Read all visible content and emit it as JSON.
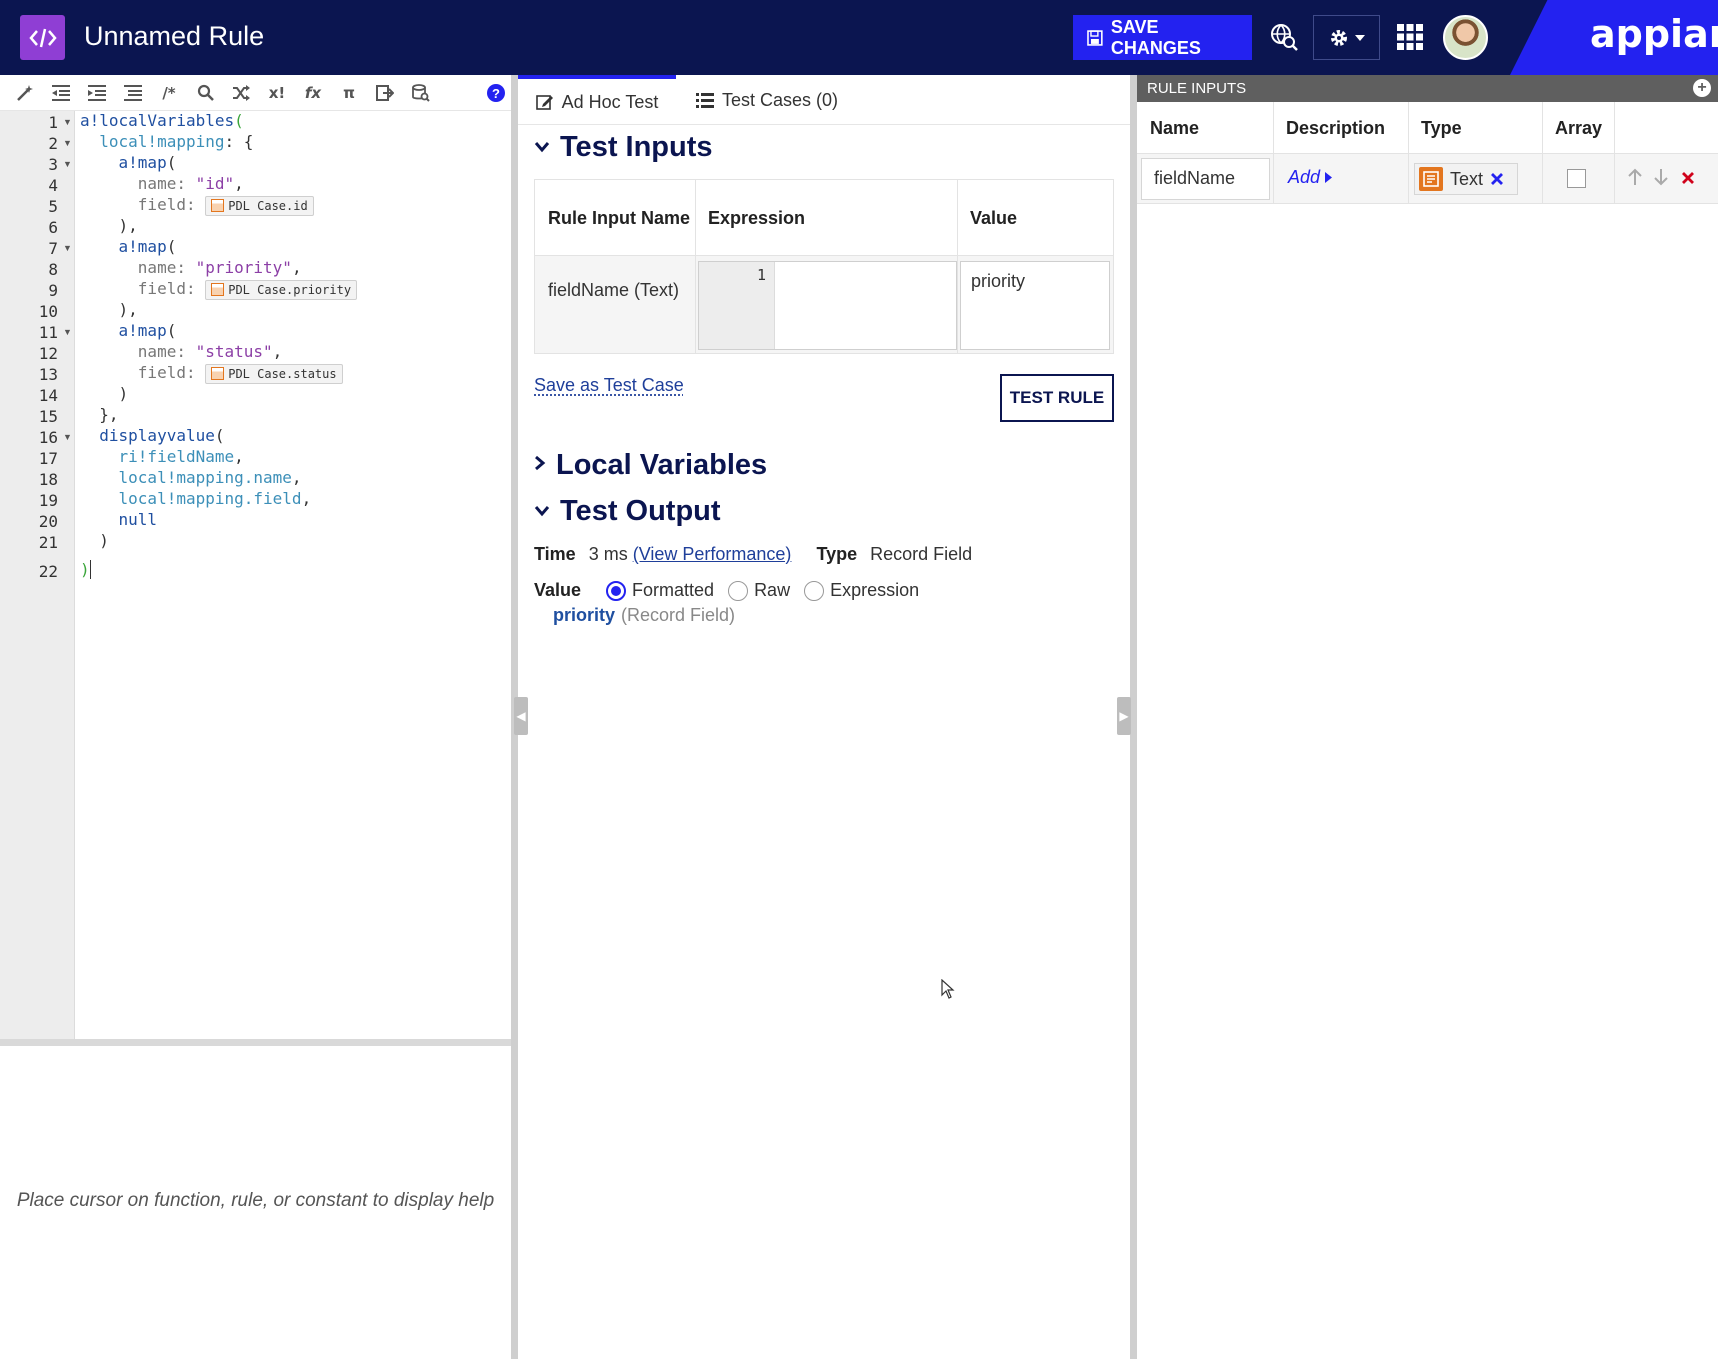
{
  "header": {
    "title": "Unnamed Rule",
    "save_label": "SAVE CHANGES",
    "brand": "appian"
  },
  "editor": {
    "lines": [
      {
        "n": "1"
      },
      {
        "n": "2"
      },
      {
        "n": "3"
      },
      {
        "n": "4"
      },
      {
        "n": "5"
      },
      {
        "n": "6"
      },
      {
        "n": "7"
      },
      {
        "n": "8"
      },
      {
        "n": "9"
      },
      {
        "n": "10"
      },
      {
        "n": "11"
      },
      {
        "n": "12"
      },
      {
        "n": "13"
      },
      {
        "n": "14"
      },
      {
        "n": "15"
      },
      {
        "n": "16"
      },
      {
        "n": "17"
      },
      {
        "n": "18"
      },
      {
        "n": "19"
      },
      {
        "n": "20"
      },
      {
        "n": "21"
      },
      {
        "n": "22"
      }
    ],
    "tokens": {
      "l1_fn": "a!localVariables",
      "l2_var": "local!mapping",
      "l3_fn": "a!map",
      "name_key": "name:",
      "field_key": "field:",
      "str_id": "\"id\"",
      "chip_id": "PDL Case.id",
      "str_priority": "\"priority\"",
      "chip_priority": "PDL Case.priority",
      "str_status": "\"status\"",
      "chip_status": "PDL Case.status",
      "fn_display": "displayvalue",
      "arg1": "ri!fieldName",
      "arg2": "local!mapping.name",
      "arg3": "local!mapping.field",
      "arg4": "null"
    },
    "help_text": "Place cursor on function, rule, or constant to display help"
  },
  "center": {
    "tabs": [
      {
        "label": "Ad Hoc Test"
      },
      {
        "label": "Test Cases (0)"
      }
    ],
    "test_inputs": {
      "title": "Test Inputs",
      "headers": [
        "Rule Input Name",
        "Expression",
        "Value"
      ],
      "row": {
        "name": "fieldName (Text)",
        "expr_line": "1",
        "value": "priority"
      }
    },
    "save_test_case": "Save as Test Case",
    "test_rule": "TEST RULE",
    "local_variables": "Local Variables",
    "test_output": {
      "title": "Test Output",
      "time_label": "Time",
      "time_value": "3 ms",
      "perf_link": "(View Performance)",
      "type_label": "Type",
      "type_value": "Record Field",
      "value_label": "Value",
      "radios": [
        "Formatted",
        "Raw",
        "Expression"
      ],
      "selected_radio": "Formatted",
      "result": "priority",
      "result_type": "(Record Field)"
    }
  },
  "rule_inputs": {
    "bar_title": "RULE INPUTS",
    "headers": [
      "Name",
      "Description",
      "Type",
      "Array"
    ],
    "row": {
      "name": "fieldName",
      "description": "Add",
      "type": "Text",
      "array": false
    }
  },
  "colors": {
    "header_bg": "#0b1550",
    "accent": "#2322f0",
    "app_icon": "#8f3ed4",
    "type_icon": "#e3761f",
    "delete": "#d0021b"
  }
}
